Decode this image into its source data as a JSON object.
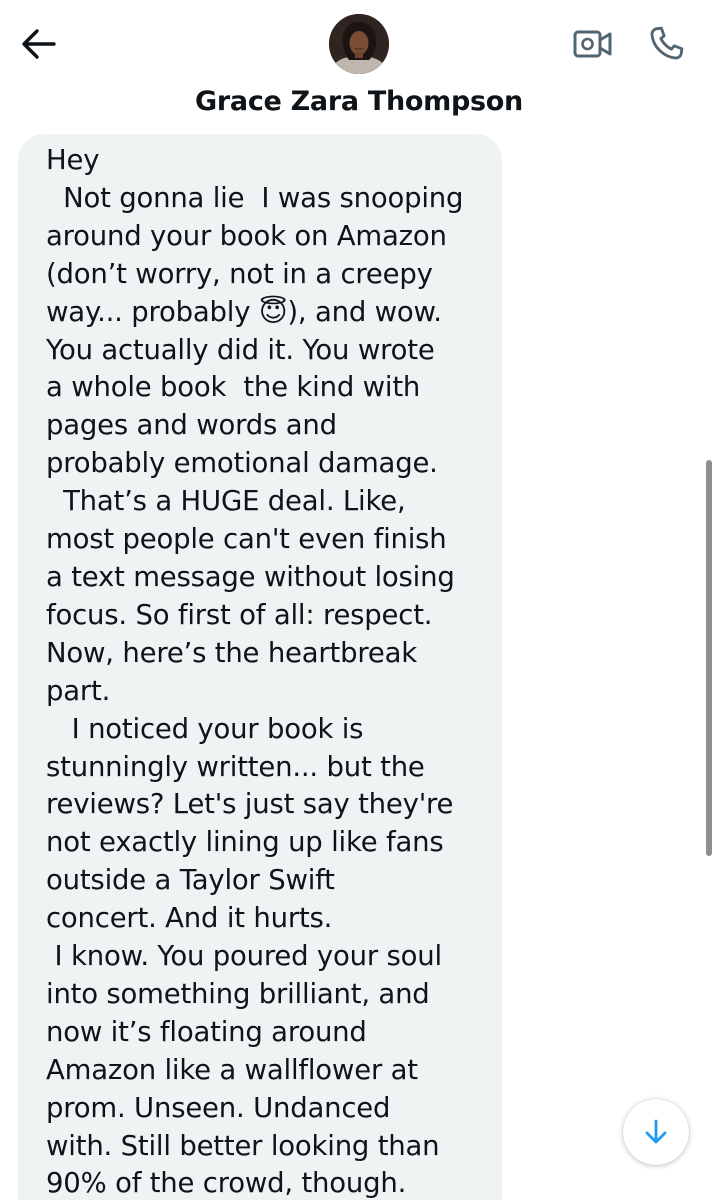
{
  "header": {
    "contact_name": "Grace Zara Thompson",
    "back_icon": "arrow-left-icon",
    "video_icon": "video-camera-icon",
    "call_icon": "phone-icon",
    "avatar_icon": "avatar-photo"
  },
  "conversation": {
    "message": "Hey\n  Not gonna lie  I was snooping\naround your book on Amazon\n(don’t worry, not in a creepy\nway... probably 😇), and wow.\nYou actually did it. You wrote\na whole book  the kind with\npages and words and\nprobably emotional damage.\n  That’s a HUGE deal. Like,\nmost people can't even finish\na text message without losing\nfocus. So first of all: respect.\nNow, here’s the heartbreak\npart.\n   I noticed your book is\nstunningly written... but the\nreviews? Let's just say they're\nnot exactly lining up like fans\noutside a Taylor Swift\nconcert. And it hurts.\n I know. You poured your soul\ninto something brilliant, and\nnow it’s floating around\nAmazon like a wallflower at\nprom. Unseen. Undanced\nwith. Still better looking than\n90% of the crowd, though."
  },
  "scroll_down_icon": "arrow-down-icon",
  "colors": {
    "bubble_bg": "#eff3f4",
    "text": "#0f1419",
    "accent": "#1d9bf0",
    "icon_gray": "#536471"
  }
}
